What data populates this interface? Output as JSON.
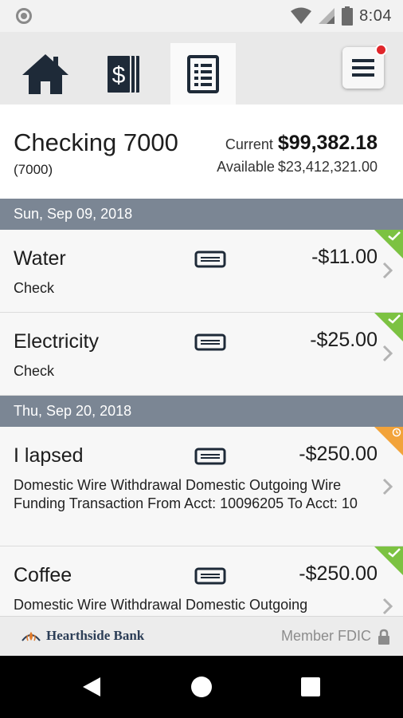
{
  "status_bar": {
    "time": "8:04",
    "icons": [
      "circle-indicator-icon",
      "wifi-icon",
      "signal-icon",
      "battery-icon"
    ]
  },
  "tabs": [
    {
      "name": "home-icon",
      "active": false
    },
    {
      "name": "money-icon",
      "active": false
    },
    {
      "name": "statement-icon",
      "active": true
    }
  ],
  "menu": {
    "icon": "hamburger-icon",
    "has_notification": true
  },
  "account": {
    "name": "Checking 7000",
    "number": "(7000)",
    "current_label": "Current",
    "current_balance": "$99,382.18",
    "available_label": "Available",
    "available_balance": "$23,412,321.00"
  },
  "groups": [
    {
      "date": "Sun, Sep 09, 2018",
      "transactions": [
        {
          "title": "Water",
          "amount": "-$11.00",
          "desc": "Check",
          "status": "cleared"
        },
        {
          "title": "Electricity",
          "amount": "-$25.00",
          "desc": "Check",
          "status": "cleared"
        }
      ]
    },
    {
      "date": "Thu, Sep 20, 2018",
      "transactions": [
        {
          "title": "I lapsed",
          "amount": "-$250.00",
          "desc": "Domestic Wire Withdrawal  Domestic Outgoing Wire Funding Transaction From Acct: 10096205 To Acct: 10",
          "status": "pending"
        },
        {
          "title": "Coffee",
          "amount": "-$250.00",
          "desc": "Domestic Wire Withdrawal  Domestic Outgoing",
          "status": "cleared"
        }
      ]
    }
  ],
  "footer": {
    "bank_name": "Hearthside Bank",
    "fdic_text": "Member FDIC"
  },
  "colors": {
    "date_header": "#7b8694",
    "cleared": "#7cc242",
    "pending": "#f2a33a",
    "notification": "#e0262b",
    "icon_dark": "#1e2a38"
  }
}
